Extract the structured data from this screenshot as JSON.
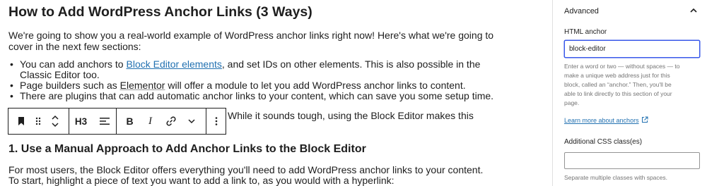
{
  "content": {
    "heading": "How to Add WordPress Anchor Links (3 Ways)",
    "intro_line1": "We're going to show you a real-world example of WordPress anchor links right now! Here's what we're going to",
    "intro_line2": "cover in the next few sections:",
    "bullets": {
      "b1_pre": "You can add anchors to ",
      "b1_link": "Block Editor elements",
      "b1_post": ", and set IDs on other elements. This is also possible in the",
      "b1_cont": "Classic Editor too.",
      "b2_pre": "Page builders such as ",
      "b2_ul": "Elementor",
      "b2_post": " will offer a module to let you add WordPress anchor links to content.",
      "b3": "There are plugins that can add automatic anchor links to your content, which can save you some setup time."
    },
    "para_after_toolbar": "While it sounds tough, using the Block Editor makes this",
    "subheading": "1. Use a Manual Approach to Add Anchor Links to the Block Editor",
    "para2_line1": "For most users, the Block Editor offers everything you'll need to add WordPress anchor links to your content.",
    "para2_line2": "To start, highlight a piece of text you want to add a link to, as you would with a hyperlink:"
  },
  "toolbar": {
    "heading_level": "H3",
    "bold": "B",
    "italic": "I",
    "icons": [
      "bookmark-icon",
      "drag-handle-icon",
      "move-up-down-icon",
      "align-icon",
      "link-icon",
      "chevron-down-icon",
      "more-options-icon"
    ]
  },
  "sidebar": {
    "panel_title": "Advanced",
    "html_anchor_label": "HTML anchor",
    "html_anchor_value": "block-editor",
    "help_lines": [
      "Enter a word or two — without spaces — to",
      "make a unique web address just for this",
      "block, called an “anchor.” Then, you'll be",
      "able to link directly to this section of your",
      "page."
    ],
    "learn_more": "Learn more about anchors",
    "css_label": "Additional CSS class(es)",
    "css_value": "",
    "css_help": "Separate multiple classes with spaces."
  },
  "colors": {
    "link": "#2271b1",
    "focus": "#3858e9",
    "help_text": "#757575"
  }
}
